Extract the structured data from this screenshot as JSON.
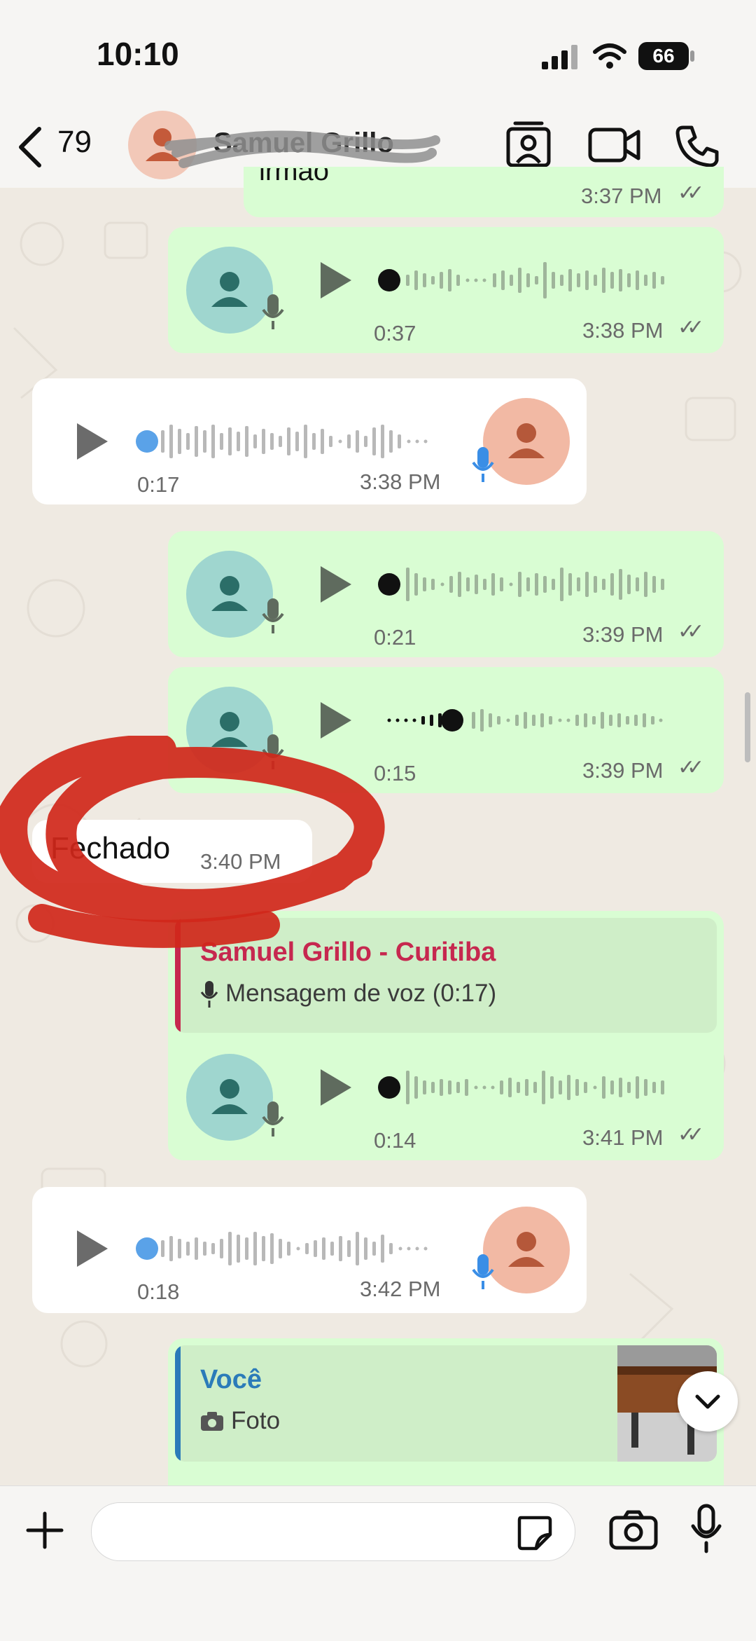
{
  "status_bar": {
    "time": "10:10",
    "battery": "66"
  },
  "header": {
    "back_count": "79",
    "contact_name": "Samuel Grillo"
  },
  "messages": {
    "m0": {
      "text_partial": "irmão",
      "time": "3:37 PM"
    },
    "m1": {
      "duration": "0:37",
      "time": "3:38 PM"
    },
    "m2": {
      "duration": "0:17",
      "time": "3:38 PM"
    },
    "m3": {
      "duration": "0:21",
      "time": "3:39 PM"
    },
    "m4": {
      "duration": "0:15",
      "time": "3:39 PM"
    },
    "m5": {
      "text": "Fechado",
      "time": "3:40 PM"
    },
    "m6": {
      "reply_author": "Samuel Grillo - Curitiba",
      "reply_text": "Mensagem de voz (0:17)",
      "duration": "0:14",
      "time": "3:41 PM"
    },
    "m7": {
      "duration": "0:18",
      "time": "3:42 PM"
    },
    "m8": {
      "reply_author": "Você",
      "reply_text": "Foto"
    }
  },
  "annotation": {
    "color": "#d0271a"
  },
  "colors": {
    "outgoing_bubble": "#d9fdd3",
    "incoming_bubble": "#ffffff",
    "reply_author_red": "#c6284f",
    "reply_author_blue": "#2b7bb9"
  }
}
